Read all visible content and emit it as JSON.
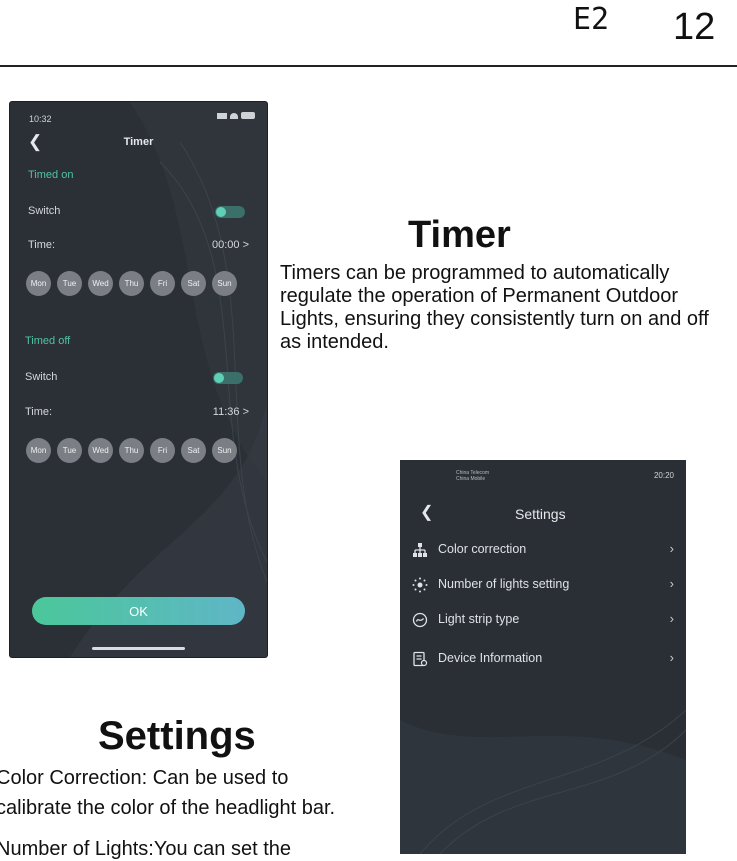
{
  "header": {
    "code": "E2",
    "page_number": "12"
  },
  "timer_phone": {
    "status_time": "10:32",
    "back_icon": "chevron-left-icon",
    "title": "Timer",
    "timed_on": {
      "section_label": "Timed on",
      "switch_label": "Switch",
      "time_label": "Time:",
      "time_value": "00:00 >",
      "days": [
        "Mon",
        "Tue",
        "Wed",
        "Thu",
        "Fri",
        "Sat",
        "Sun"
      ]
    },
    "timed_off": {
      "section_label": "Timed off",
      "switch_label": "Switch",
      "time_label": "Time:",
      "time_value": "11:36 >",
      "days": [
        "Mon",
        "Tue",
        "Wed",
        "Thu",
        "Fri",
        "Sat",
        "Sun"
      ]
    },
    "ok_label": "OK",
    "toggle_color": "#5fd0b5",
    "accent_green": "#4fc3a2"
  },
  "timer_section": {
    "heading": "Timer",
    "body": "Timers can be programmed to automatically regulate the operation of Permanent Outdoor Lights, ensuring they consistently turn on and off as intended."
  },
  "settings_section": {
    "heading": "Settings",
    "line1": "Color Correction: Can be used to",
    "line2": "calibrate the color of the headlight bar.",
    "line3": "Number of  Lights:You can set the"
  },
  "settings_phone": {
    "status_left_1": "China Telecom",
    "status_left_2": "China Mobile",
    "status_time": "20:20",
    "title": "Settings",
    "items": [
      {
        "label": "Color correction",
        "icon": "network-icon"
      },
      {
        "label": "Number of lights setting",
        "icon": "light-dots-icon"
      },
      {
        "label": "Light strip type",
        "icon": "strip-circle-icon"
      },
      {
        "label": "Device Information",
        "icon": "device-info-icon"
      }
    ]
  }
}
